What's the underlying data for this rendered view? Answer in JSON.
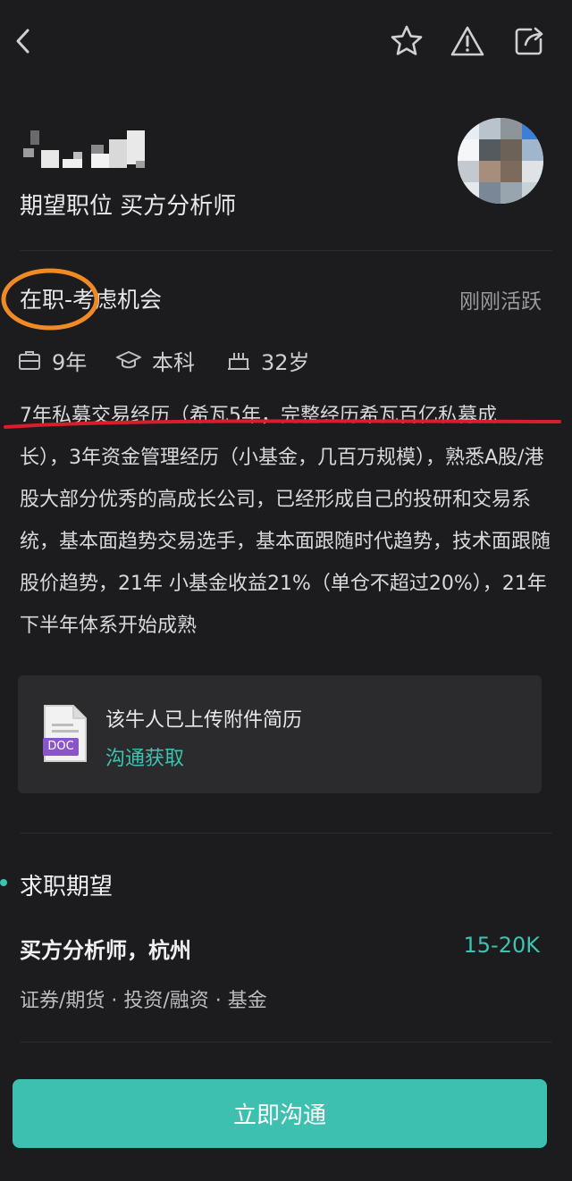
{
  "header": {
    "back_icon": "chevron-left-icon",
    "star_icon": "star-icon",
    "warning_icon": "warning-icon",
    "share_icon": "share-icon"
  },
  "profile": {
    "expected_position_label": "期望职位 买方分析师",
    "status": "在职-考虑机会",
    "active": "刚刚活跃",
    "experience": "9年",
    "education": "本科",
    "age": "32岁"
  },
  "bio": {
    "line1": "7年私募交易经历（希瓦5年，完整经历希瓦百亿私募成",
    "rest": "长），3年资金管理经历（小基金，几百万规模），熟悉A股/港股大部分优秀的高成长公司，已经形成自己的投研和交易系统，基本面趋势交易选手，基本面跟随时代趋势，技术面跟随股价趋势，21年 小基金收益21%（单仓不超过20%），21年下半年体系开始成熟"
  },
  "attachment": {
    "doc_label": "DOC",
    "title": "该牛人已上传附件简历",
    "action": "沟通获取"
  },
  "expectation": {
    "section_title": "求职期望",
    "position_city": "买方分析师，杭州",
    "salary": "15-20K",
    "industries": "证券/期货 · 投资/融资 · 基金"
  },
  "cta": {
    "label": "立即沟通"
  },
  "colors": {
    "background": "#1c1c1e",
    "accent": "#3cc3b2",
    "annotation_circle": "#f08a24",
    "annotation_underline": "#d81e2c"
  }
}
